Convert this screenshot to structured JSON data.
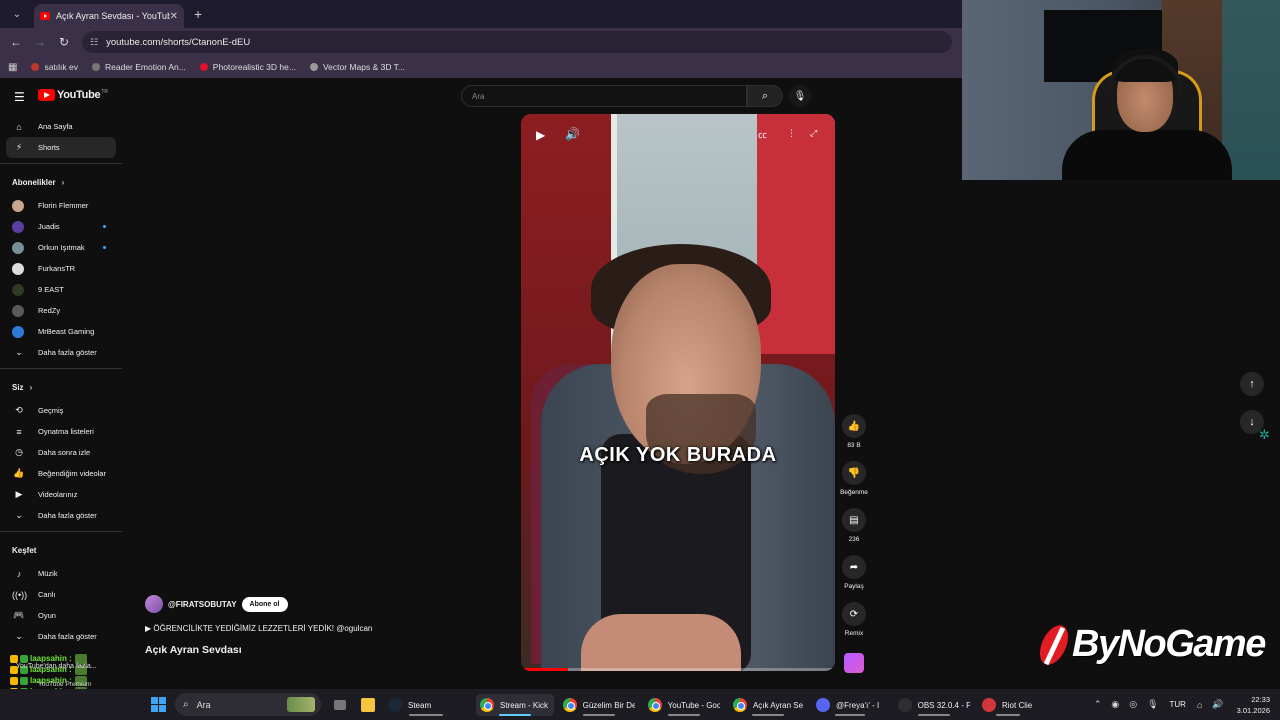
{
  "browser": {
    "tab_title": "Açık Ayran Sevdası - YouTube",
    "url": "youtube.com/shorts/CtanonE-dEU",
    "bookmarks": [
      "satılık ev",
      "Reader Emotion An...",
      "Photorealistic 3D he...",
      "Vector Maps & 3D T..."
    ]
  },
  "yt": {
    "logo": "YouTube",
    "logo_region": "TR",
    "search_placeholder": "Ara"
  },
  "sidebar": {
    "top": [
      {
        "label": "Ana Sayfa",
        "icon": "home-icon"
      },
      {
        "label": "Shorts",
        "icon": "shorts-icon",
        "active": true
      }
    ],
    "subs_header": "Abonelikler",
    "subs": [
      {
        "label": "Florin Flemmer",
        "color": "#c9a48e",
        "live": false
      },
      {
        "label": "Juadis",
        "color": "#5b3fa0",
        "live": true
      },
      {
        "label": "Orkun Işıtmak",
        "color": "#7a8c95",
        "live": true
      },
      {
        "label": "FurkansTR",
        "color": "#dddddd",
        "live": false
      },
      {
        "label": "9 EAST",
        "color": "#303a22",
        "live": false
      },
      {
        "label": "RedZy",
        "color": "#5a5a5a",
        "live": false
      },
      {
        "label": "MrBeast Gaming",
        "color": "#2e7bd6",
        "live": false
      }
    ],
    "subs_more": "Daha fazla göster",
    "you_header": "Siz",
    "you": [
      {
        "label": "Geçmiş",
        "icon": "history-icon"
      },
      {
        "label": "Oynatma listeleri",
        "icon": "playlist-icon"
      },
      {
        "label": "Daha sonra izle",
        "icon": "clock-icon"
      },
      {
        "label": "Beğendiğim videolar",
        "icon": "like-icon"
      },
      {
        "label": "Videolarınız",
        "icon": "video-icon"
      }
    ],
    "you_more": "Daha fazla göster",
    "explore_header": "Keşfet",
    "explore": [
      {
        "label": "Müzik",
        "icon": "music-icon"
      },
      {
        "label": "Canlı",
        "icon": "live-icon"
      },
      {
        "label": "Oyun",
        "icon": "gamepad-icon"
      }
    ],
    "explore_more": "Daha fazla göster"
  },
  "video": {
    "caption": "AÇIK YOK BURADA",
    "progress": 0.15
  },
  "actions": {
    "likes": "83 B",
    "dislike": "Beğenme",
    "comments": "236",
    "share": "Paylaş",
    "remix": "Remix"
  },
  "channel": {
    "handle": "@FIRATSOBUTAY",
    "subscribe": "Abone ol",
    "description": "▶ ÖĞRENCİLİKTE YEDİĞİMİZ LEZZETLERİ YEDİK! @ogulcan",
    "title": "Açık Ayran Sevdası"
  },
  "overlay": {
    "brand": "ByNoGame",
    "chat_user": "laapsahin :",
    "chat_line2": "YouTube'dan daha fazla...",
    "chat_line3": "YouTube Premium"
  },
  "taskbar": {
    "search": "Ara",
    "apps": [
      {
        "label": "Steam",
        "color": "#1b2838"
      },
      {
        "label": "Stream - Kick",
        "chrome": true,
        "active": true
      },
      {
        "label": "Güzelim Bir De",
        "chrome": true
      },
      {
        "label": "YouTube - Goo",
        "chrome": true
      },
      {
        "label": "Açık Ayran Se",
        "chrome": true
      },
      {
        "label": "@Freya'ı' - I",
        "color": "#5865f2"
      },
      {
        "label": "OBS 32.0.4 - P",
        "color": "#302e31"
      },
      {
        "label": "Riot Clie",
        "color": "#d13639"
      }
    ],
    "lang": "TUR",
    "time": "22:33",
    "date": "3.01.2026"
  }
}
